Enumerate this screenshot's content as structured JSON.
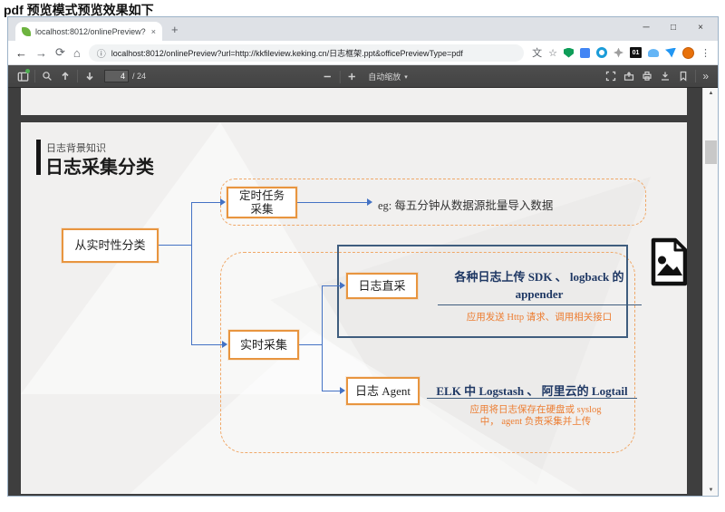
{
  "page_heading": "pdf 预览模式预览效果如下",
  "browser": {
    "tab_title": "localhost:8012/onlinePreview?",
    "tab_close": "×",
    "new_tab": "+",
    "window_controls": {
      "minimize": "─",
      "maximize": "□",
      "close": "×"
    },
    "url": "localhost:8012/onlinePreview?url=http://kkfileview.keking.cn/日志框架.ppt&officePreviewType=pdf",
    "extension_badge": "01"
  },
  "icons": {
    "back": "←",
    "forward": "→",
    "reload": "⟳",
    "home": "⌂",
    "info": "ⓘ",
    "star": "☆",
    "translate": "文",
    "menu": "⋮",
    "scroll_up": "▲",
    "scroll_down": "▼",
    "caret": "▾",
    "more": "»"
  },
  "pdf_toolbar": {
    "page_input": "4",
    "page_count": "/ 24",
    "zoom_label": "自动缩放"
  },
  "slide": {
    "kicker": "日志背景知识",
    "title": "日志采集分类",
    "root": "从实时性分类",
    "scheduled": {
      "box": "定时任务\n采集",
      "note": "eg: 每五分钟从数据源批量导入数据"
    },
    "realtime": {
      "box": "实时采集",
      "direct": {
        "box": "日志直采",
        "heading_line1": "各种日志上传 SDK 、 logback 的",
        "heading_line2": "appender",
        "sub": "应用发送 Http 请求、调用相关接口"
      },
      "agent": {
        "box": "日志 Agent",
        "heading": "ELK 中 Logstash 、 阿里云的 Logtail",
        "sub_line1": "应用将日志保存在硬盘或 syslog",
        "sub_line2": "中， agent 负责采集并上传"
      }
    }
  },
  "colors": {
    "accent_orange": "#e8953f",
    "dashed_orange": "#f0a868",
    "line_blue": "#4472c4",
    "navy_text": "#1f3864",
    "frame_navy": "#3f5d7e",
    "orange_text": "#ed7d31",
    "toolbar_bg": "#474747",
    "viewer_bg": "#3e3e3e"
  }
}
